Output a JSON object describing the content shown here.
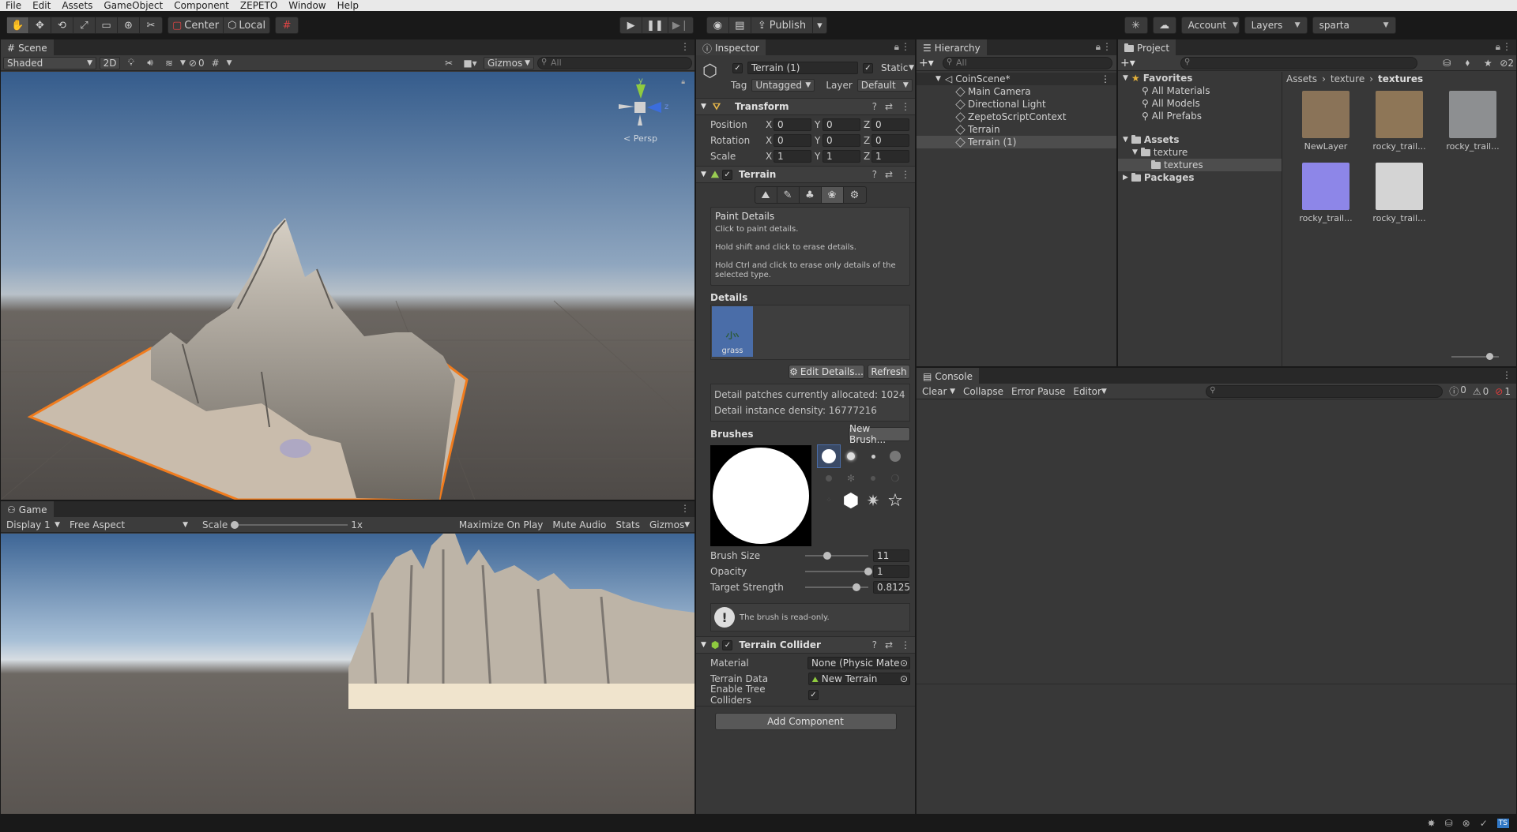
{
  "menu": [
    "File",
    "Edit",
    "Assets",
    "GameObject",
    "Component",
    "ZEPETO",
    "Window",
    "Help"
  ],
  "toolbar": {
    "pivot_label": "Center",
    "space_label": "Local",
    "publish_label": "Publish",
    "account_label": "Account",
    "layers_label": "Layers",
    "layout_label": "sparta"
  },
  "scene": {
    "tab_label": "Scene",
    "shading_mode": "Shaded",
    "mode_2d": "2D",
    "hidden_count": "0",
    "gizmos_label": "Gizmos",
    "search_placeholder": "All",
    "persp_label": "< Persp",
    "axis_y": "y",
    "axis_z": "z"
  },
  "game": {
    "tab_label": "Game",
    "display_label": "Display 1",
    "aspect_label": "Free Aspect",
    "scale_label": "Scale",
    "scale_value": "1x",
    "scale_fraction": 0.0,
    "maximize_label": "Maximize On Play",
    "mute_label": "Mute Audio",
    "stats_label": "Stats",
    "gizmos_label": "Gizmos"
  },
  "inspector": {
    "tab_label": "Inspector",
    "object_name": "Terrain (1)",
    "static_label": "Static",
    "tag_label": "Tag",
    "tag_value": "Untagged",
    "layer_label": "Layer",
    "layer_value": "Default",
    "transform": {
      "title": "Transform",
      "position_label": "Position",
      "rotation_label": "Rotation",
      "scale_label": "Scale",
      "axis_x": "X",
      "axis_y": "Y",
      "axis_z": "Z",
      "position": [
        "0",
        "0",
        "0"
      ],
      "rotation": [
        "0",
        "0",
        "0"
      ],
      "scale": [
        "1",
        "1",
        "1"
      ]
    },
    "terrain": {
      "title": "Terrain",
      "paint_title": "Paint Details",
      "paint_line1": "Click to paint details.",
      "paint_line2": "Hold shift and click to erase details.",
      "paint_line3": "Hold Ctrl and click to erase only details of the selected type.",
      "details_label": "Details",
      "detail_item": "grass",
      "edit_details_label": "Edit Details...",
      "refresh_label": "Refresh",
      "patches_text": "Detail patches currently allocated: 1024",
      "density_text": "Detail instance density: 16777216",
      "brushes_label": "Brushes",
      "new_brush_label": "New Brush...",
      "brush_size_label": "Brush Size",
      "brush_size_value": "11",
      "brush_size_fraction": 0.35,
      "opacity_label": "Opacity",
      "opacity_value": "1",
      "opacity_fraction": 1.0,
      "strength_label": "Target Strength",
      "strength_value": "0.8125",
      "strength_fraction": 0.8125,
      "readonly_text": "The brush is read-only."
    },
    "collider": {
      "title": "Terrain Collider",
      "material_label": "Material",
      "material_value": "None (Physic Mater",
      "data_label": "Terrain Data",
      "data_value": "New Terrain",
      "tree_label": "Enable Tree Colliders",
      "tree_checked": "✓"
    },
    "add_component_label": "Add Component"
  },
  "hierarchy": {
    "tab_label": "Hierarchy",
    "search_placeholder": "All",
    "scene_name": "CoinScene*",
    "items": [
      "Main Camera",
      "Directional Light",
      "ZepetoScriptContext",
      "Terrain",
      "Terrain (1)"
    ]
  },
  "project": {
    "tab_label": "Project",
    "favorites_label": "Favorites",
    "favorites": [
      "All Materials",
      "All Models",
      "All Prefabs"
    ],
    "assets_label": "Assets",
    "texture_folder": "texture",
    "textures_folder": "textures",
    "packages_label": "Packages",
    "breadcrumb": [
      "Assets",
      "texture",
      "textures"
    ],
    "badge_count": "2",
    "assets": [
      {
        "label": "NewLayer",
        "color": "#8a7358"
      },
      {
        "label": "rocky_trail...",
        "color": "#8e7657"
      },
      {
        "label": "rocky_trail...",
        "color": "#8d8f91"
      },
      {
        "label": "rocky_trail...",
        "color": "#8d86e8"
      },
      {
        "label": "rocky_trail...",
        "color": "#d4d4d4"
      }
    ]
  },
  "console": {
    "tab_label": "Console",
    "clear_label": "Clear",
    "collapse_label": "Collapse",
    "error_pause_label": "Error Pause",
    "editor_label": "Editor",
    "info_count": "0",
    "warn_count": "0",
    "error_count": "1"
  },
  "colors": {
    "accent": "#4a6da8",
    "selection_outline": "#f07c1e",
    "error": "#e03c3c"
  }
}
